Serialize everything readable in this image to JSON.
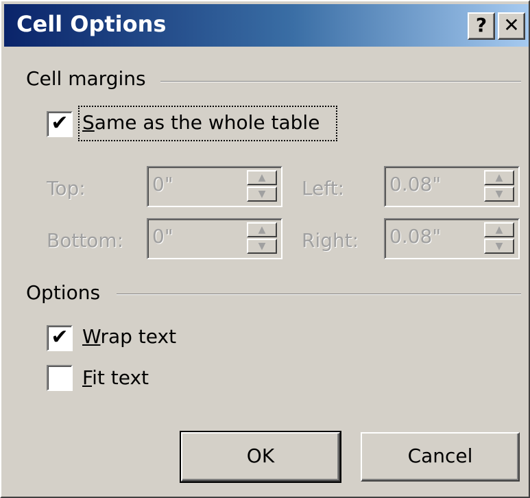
{
  "window": {
    "title": "Cell Options",
    "help_glyph": "?",
    "close_glyph": "✕"
  },
  "cell_margins": {
    "group_label": "Cell margins",
    "same_as_table": {
      "checked": true,
      "label_first": "S",
      "label_rest": "ame as the whole table"
    },
    "fields": {
      "top": {
        "label": "Top:",
        "value": "0\""
      },
      "left": {
        "label": "Left:",
        "value": "0.08\""
      },
      "bottom": {
        "label": "Bottom:",
        "value": "0\""
      },
      "right": {
        "label": "Right:",
        "value": "0.08\""
      }
    },
    "disabled": true
  },
  "options": {
    "group_label": "Options",
    "wrap_text": {
      "checked": true,
      "label_first": "W",
      "label_rest": "rap text"
    },
    "fit_text": {
      "checked": false,
      "label_first": "F",
      "label_rest": "it text"
    }
  },
  "buttons": {
    "ok": "OK",
    "cancel": "Cancel"
  },
  "check_glyph": "✔",
  "spin_up_glyph": "▲",
  "spin_down_glyph": "▼"
}
